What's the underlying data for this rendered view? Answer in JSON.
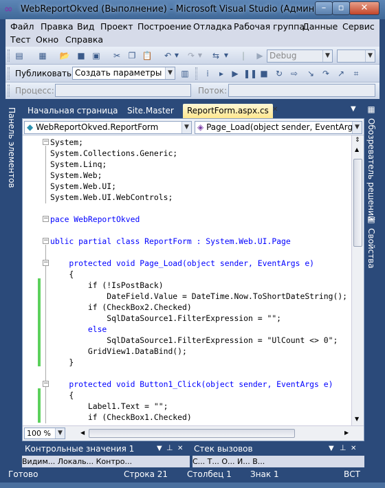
{
  "window": {
    "title": "WebReportOkved (Выполнение) - Microsoft Visual Studio (Администратор)"
  },
  "menu": [
    "Файл",
    "Правка",
    "Вид",
    "Проект",
    "Построение",
    "Отладка",
    "Рабочая группа",
    "Данные",
    "Сервис",
    "Тест",
    "Окно",
    "Справка"
  ],
  "toolbar1": {
    "config_combo": "Debug"
  },
  "toolbar2": {
    "publish_label": "Публиковать:",
    "publish_combo": "Создать параметры пуб"
  },
  "toolbar3": {
    "process_label": "Процесс:",
    "thread_label": "Поток:"
  },
  "left_panel": {
    "label": "Панель элементов"
  },
  "right_panel": {
    "solution_label": "Обозреватель решений",
    "properties_label": "Свойства"
  },
  "tabs": [
    "Начальная страница",
    "Site.Master",
    "ReportForm.aspx.cs"
  ],
  "navbar": {
    "class_combo": "WebReportOkved.ReportForm",
    "member_combo": "Page_Load(object sender, EventArgs e)"
  },
  "code_lines": [
    "System;",
    "System.Collections.Generic;",
    "System.Linq;",
    "System.Web;",
    "System.Web.UI;",
    "System.Web.UI.WebControls;",
    "",
    "pace WebReportOkved",
    "",
    "ublic partial class ReportForm : System.Web.UI.Page",
    "",
    "    protected void Page_Load(object sender, EventArgs e)",
    "    {",
    "        if (!IsPostBack)",
    "            DateField.Value = DateTime.Now.ToShortDateString();",
    "        if (CheckBox2.Checked)",
    "            SqlDataSource1.FilterExpression = \"\";",
    "        else",
    "            SqlDataSource1.FilterExpression = \"UlCount <> 0\";",
    "        GridView1.DataBind();",
    "    }",
    "",
    "    protected void Button1_Click(object sender, EventArgs e)",
    "    {",
    "        Label1.Text = \"\";",
    "        if (CheckBox1.Checked)"
  ],
  "editor": {
    "zoom": "100 %"
  },
  "bottom": {
    "watch_title": "Контрольные значения 1",
    "watch_strip": "Видим...  Локаль...  Контро...",
    "callstack_title": "Стек вызовов",
    "callstack_strip": "С...  Т...  О...  И...  В..."
  },
  "status": {
    "ready": "Готово",
    "line": "Строка 21",
    "col": "Столбец 1",
    "char": "Знак 1",
    "mode": "ВСТ"
  }
}
